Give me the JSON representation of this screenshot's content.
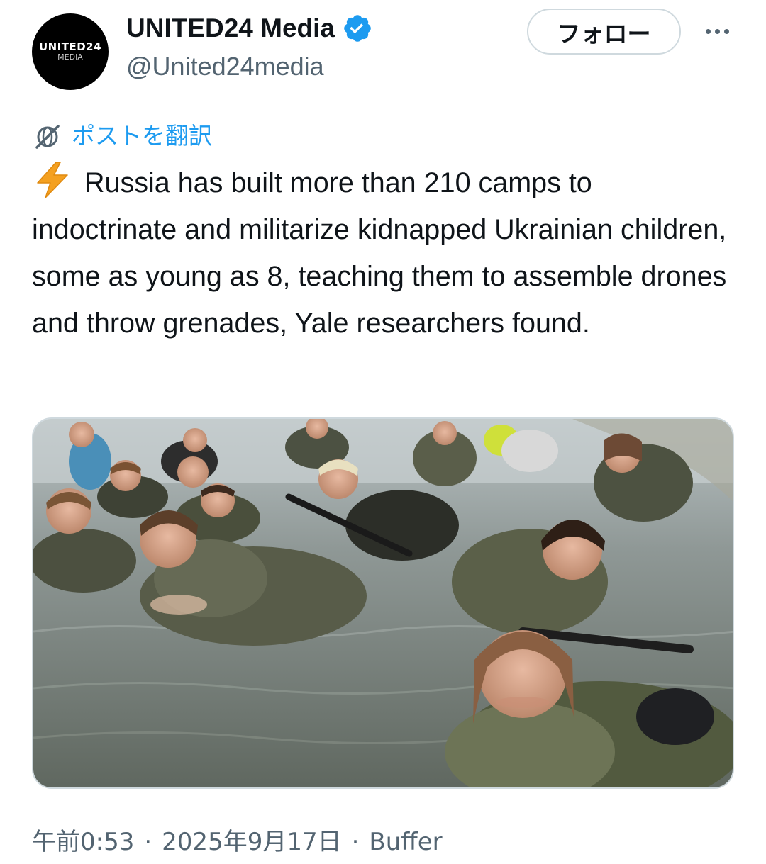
{
  "author": {
    "display_name": "UNITED24 Media",
    "handle": "@United24media",
    "avatar_text_line1": "UNITED24",
    "avatar_text_line2": "MEDIA",
    "verified_icon": "verified-badge-icon",
    "verified_color": "#1d9bf0"
  },
  "actions": {
    "follow_label": "フォロー",
    "more_icon": "more-dots-icon"
  },
  "translate": {
    "label": "ポストを翻訳",
    "icon": "globe-slash-icon",
    "color": "#1d9bf0"
  },
  "post": {
    "emoji_icon": "lightning-bolt-icon",
    "text": "Russia has built more than 210 camps to indoctrinate and militarize kidnapped Ukrainian children, some as young as 8, teaching them to assemble drones and throw grenades, Yale researchers found."
  },
  "media": {
    "type": "photo"
  },
  "meta": {
    "time": "午前0:53",
    "date": "2025年9月17日",
    "source": "Buffer",
    "separator": "·"
  },
  "colors": {
    "text_primary": "#0f1419",
    "text_secondary": "#536471",
    "accent": "#1d9bf0",
    "border": "#cfd9de"
  }
}
